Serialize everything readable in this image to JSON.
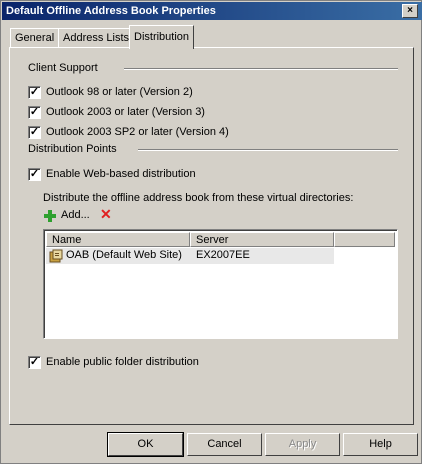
{
  "window": {
    "title": "Default Offline Address Book Properties",
    "close_glyph": "×"
  },
  "tabs": [
    {
      "label": "General"
    },
    {
      "label": "Address Lists"
    },
    {
      "label": "Distribution"
    }
  ],
  "client_support": {
    "heading": "Client Support",
    "options": [
      {
        "label": "Outlook 98 or later (Version 2)",
        "checked": true
      },
      {
        "label": "Outlook 2003 or later (Version 3)",
        "checked": true
      },
      {
        "label": "Outlook 2003 SP2 or later (Version 4)",
        "checked": true
      }
    ]
  },
  "distribution_points": {
    "heading": "Distribution Points",
    "web_based": {
      "label": "Enable Web-based distribution",
      "checked": true
    },
    "description": "Distribute the offline address book from these virtual directories:",
    "add_label": "Add...",
    "remove_glyph": "✕",
    "columns": [
      "Name",
      "Server"
    ],
    "rows": [
      {
        "name": "OAB (Default Web Site)",
        "server": "EX2007EE"
      }
    ],
    "public_folder": {
      "label": "Enable public folder distribution",
      "checked": true
    }
  },
  "check_glyph": "✓",
  "buttons": {
    "ok": "OK",
    "cancel": "Cancel",
    "apply": "Apply",
    "help": "Help"
  },
  "colors": {
    "titlebar": "#0a246a",
    "dialog": "#d4d0c8",
    "add_icon": "#2ea02e",
    "remove_icon": "#e02020"
  }
}
